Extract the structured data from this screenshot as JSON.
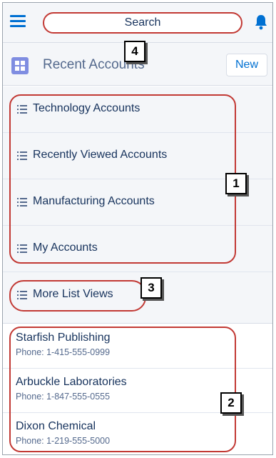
{
  "header": {
    "search_placeholder": "Search",
    "title": "Recent Accounts",
    "new_label": "New"
  },
  "list_views": [
    {
      "label": "Technology Accounts"
    },
    {
      "label": "Recently Viewed Accounts"
    },
    {
      "label": "Manufacturing Accounts"
    },
    {
      "label": "My Accounts"
    }
  ],
  "more_list_views": "More List Views",
  "records": [
    {
      "name": "Starfish Publishing",
      "phone": "Phone: 1-415-555-0999"
    },
    {
      "name": "Arbuckle Laboratories",
      "phone": "Phone: 1-847-555-0555"
    },
    {
      "name": "Dixon Chemical",
      "phone": "Phone: 1-219-555-5000"
    }
  ],
  "callouts": [
    "1",
    "2",
    "3",
    "4"
  ],
  "colors": {
    "accent": "#0070d2",
    "callout_red": "#c23934",
    "list_icon": "#7f8de1",
    "header_bg": "#f4f6f9"
  },
  "icons": [
    "menu-icon",
    "bell-icon",
    "list-view-icon",
    "list-icon"
  ]
}
